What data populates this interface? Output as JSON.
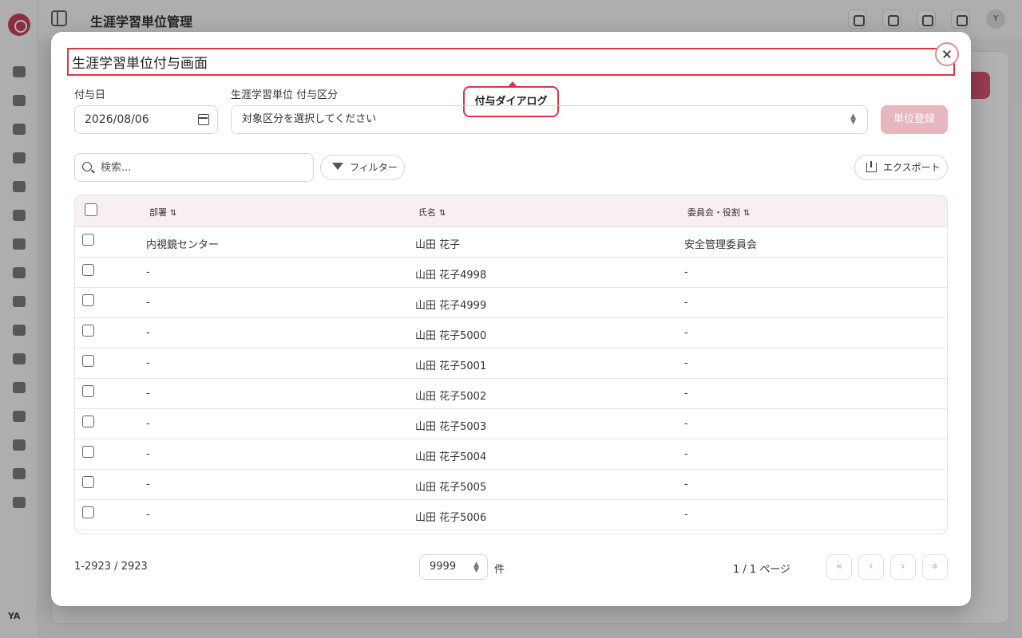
{
  "app": {
    "header_title": "生涯学習単位管理",
    "avatar_initial": "Y",
    "user_initials": "YA"
  },
  "dialog": {
    "title": "生涯学習単位付与画面",
    "callout": "付与ダイアログ",
    "date_label": "付与日",
    "date_value": "2026/08/06",
    "category_label": "生涯学習単位 付与区分",
    "category_placeholder": "対象区分を選択してください",
    "register_button": "単位登録",
    "search_placeholder": "検索...",
    "filter_button": "フィルター",
    "export_button": "エクスポート"
  },
  "table": {
    "columns": [
      "部署",
      "氏名",
      "委員会・役割"
    ],
    "sort_glyph": "⇅",
    "rows": [
      {
        "dept": "内視鏡センター",
        "name": "山田 花子",
        "role": "安全管理委員会"
      },
      {
        "dept": "-",
        "name": "山田 花子4998",
        "role": "-"
      },
      {
        "dept": "-",
        "name": "山田 花子4999",
        "role": "-"
      },
      {
        "dept": "-",
        "name": "山田 花子5000",
        "role": "-"
      },
      {
        "dept": "-",
        "name": "山田 花子5001",
        "role": "-"
      },
      {
        "dept": "-",
        "name": "山田 花子5002",
        "role": "-"
      },
      {
        "dept": "-",
        "name": "山田 花子5003",
        "role": "-"
      },
      {
        "dept": "-",
        "name": "山田 花子5004",
        "role": "-"
      },
      {
        "dept": "-",
        "name": "山田 花子5005",
        "role": "-"
      },
      {
        "dept": "-",
        "name": "山田 花子5006",
        "role": "-"
      }
    ]
  },
  "pagination": {
    "range": "1-2923 / 2923",
    "page_size": "9999",
    "unit": "件",
    "page_info": "1 / 1 ページ",
    "first": "«",
    "prev": "‹",
    "next": "›",
    "last": "»"
  },
  "colors": {
    "accent": "#d85a73",
    "highlight": "#dc3545",
    "register_disabled": "#e7b6bf"
  }
}
